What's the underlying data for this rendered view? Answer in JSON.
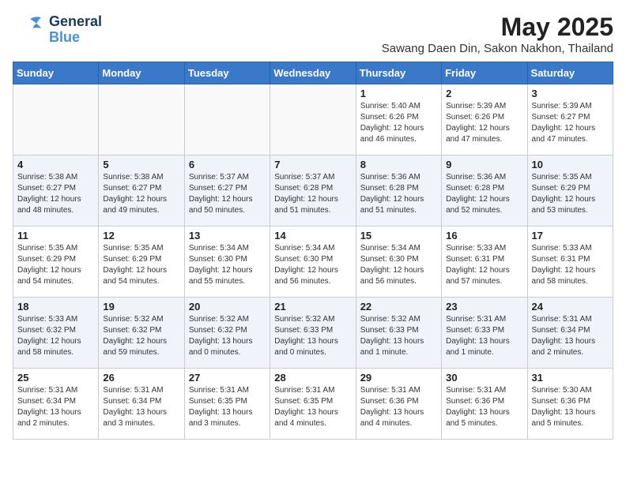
{
  "logo": {
    "general": "General",
    "blue": "Blue"
  },
  "title": "May 2025",
  "subtitle": "Sawang Daen Din, Sakon Nakhon, Thailand",
  "headers": [
    "Sunday",
    "Monday",
    "Tuesday",
    "Wednesday",
    "Thursday",
    "Friday",
    "Saturday"
  ],
  "weeks": [
    [
      {
        "day": "",
        "detail": ""
      },
      {
        "day": "",
        "detail": ""
      },
      {
        "day": "",
        "detail": ""
      },
      {
        "day": "",
        "detail": ""
      },
      {
        "day": "1",
        "detail": "Sunrise: 5:40 AM\nSunset: 6:26 PM\nDaylight: 12 hours\nand 46 minutes."
      },
      {
        "day": "2",
        "detail": "Sunrise: 5:39 AM\nSunset: 6:26 PM\nDaylight: 12 hours\nand 47 minutes."
      },
      {
        "day": "3",
        "detail": "Sunrise: 5:39 AM\nSunset: 6:27 PM\nDaylight: 12 hours\nand 47 minutes."
      }
    ],
    [
      {
        "day": "4",
        "detail": "Sunrise: 5:38 AM\nSunset: 6:27 PM\nDaylight: 12 hours\nand 48 minutes."
      },
      {
        "day": "5",
        "detail": "Sunrise: 5:38 AM\nSunset: 6:27 PM\nDaylight: 12 hours\nand 49 minutes."
      },
      {
        "day": "6",
        "detail": "Sunrise: 5:37 AM\nSunset: 6:27 PM\nDaylight: 12 hours\nand 50 minutes."
      },
      {
        "day": "7",
        "detail": "Sunrise: 5:37 AM\nSunset: 6:28 PM\nDaylight: 12 hours\nand 51 minutes."
      },
      {
        "day": "8",
        "detail": "Sunrise: 5:36 AM\nSunset: 6:28 PM\nDaylight: 12 hours\nand 51 minutes."
      },
      {
        "day": "9",
        "detail": "Sunrise: 5:36 AM\nSunset: 6:28 PM\nDaylight: 12 hours\nand 52 minutes."
      },
      {
        "day": "10",
        "detail": "Sunrise: 5:35 AM\nSunset: 6:29 PM\nDaylight: 12 hours\nand 53 minutes."
      }
    ],
    [
      {
        "day": "11",
        "detail": "Sunrise: 5:35 AM\nSunset: 6:29 PM\nDaylight: 12 hours\nand 54 minutes."
      },
      {
        "day": "12",
        "detail": "Sunrise: 5:35 AM\nSunset: 6:29 PM\nDaylight: 12 hours\nand 54 minutes."
      },
      {
        "day": "13",
        "detail": "Sunrise: 5:34 AM\nSunset: 6:30 PM\nDaylight: 12 hours\nand 55 minutes."
      },
      {
        "day": "14",
        "detail": "Sunrise: 5:34 AM\nSunset: 6:30 PM\nDaylight: 12 hours\nand 56 minutes."
      },
      {
        "day": "15",
        "detail": "Sunrise: 5:34 AM\nSunset: 6:30 PM\nDaylight: 12 hours\nand 56 minutes."
      },
      {
        "day": "16",
        "detail": "Sunrise: 5:33 AM\nSunset: 6:31 PM\nDaylight: 12 hours\nand 57 minutes."
      },
      {
        "day": "17",
        "detail": "Sunrise: 5:33 AM\nSunset: 6:31 PM\nDaylight: 12 hours\nand 58 minutes."
      }
    ],
    [
      {
        "day": "18",
        "detail": "Sunrise: 5:33 AM\nSunset: 6:32 PM\nDaylight: 12 hours\nand 58 minutes."
      },
      {
        "day": "19",
        "detail": "Sunrise: 5:32 AM\nSunset: 6:32 PM\nDaylight: 12 hours\nand 59 minutes."
      },
      {
        "day": "20",
        "detail": "Sunrise: 5:32 AM\nSunset: 6:32 PM\nDaylight: 13 hours\nand 0 minutes."
      },
      {
        "day": "21",
        "detail": "Sunrise: 5:32 AM\nSunset: 6:33 PM\nDaylight: 13 hours\nand 0 minutes."
      },
      {
        "day": "22",
        "detail": "Sunrise: 5:32 AM\nSunset: 6:33 PM\nDaylight: 13 hours\nand 1 minute."
      },
      {
        "day": "23",
        "detail": "Sunrise: 5:31 AM\nSunset: 6:33 PM\nDaylight: 13 hours\nand 1 minute."
      },
      {
        "day": "24",
        "detail": "Sunrise: 5:31 AM\nSunset: 6:34 PM\nDaylight: 13 hours\nand 2 minutes."
      }
    ],
    [
      {
        "day": "25",
        "detail": "Sunrise: 5:31 AM\nSunset: 6:34 PM\nDaylight: 13 hours\nand 2 minutes."
      },
      {
        "day": "26",
        "detail": "Sunrise: 5:31 AM\nSunset: 6:34 PM\nDaylight: 13 hours\nand 3 minutes."
      },
      {
        "day": "27",
        "detail": "Sunrise: 5:31 AM\nSunset: 6:35 PM\nDaylight: 13 hours\nand 3 minutes."
      },
      {
        "day": "28",
        "detail": "Sunrise: 5:31 AM\nSunset: 6:35 PM\nDaylight: 13 hours\nand 4 minutes."
      },
      {
        "day": "29",
        "detail": "Sunrise: 5:31 AM\nSunset: 6:36 PM\nDaylight: 13 hours\nand 4 minutes."
      },
      {
        "day": "30",
        "detail": "Sunrise: 5:31 AM\nSunset: 6:36 PM\nDaylight: 13 hours\nand 5 minutes."
      },
      {
        "day": "31",
        "detail": "Sunrise: 5:30 AM\nSunset: 6:36 PM\nDaylight: 13 hours\nand 5 minutes."
      }
    ]
  ]
}
